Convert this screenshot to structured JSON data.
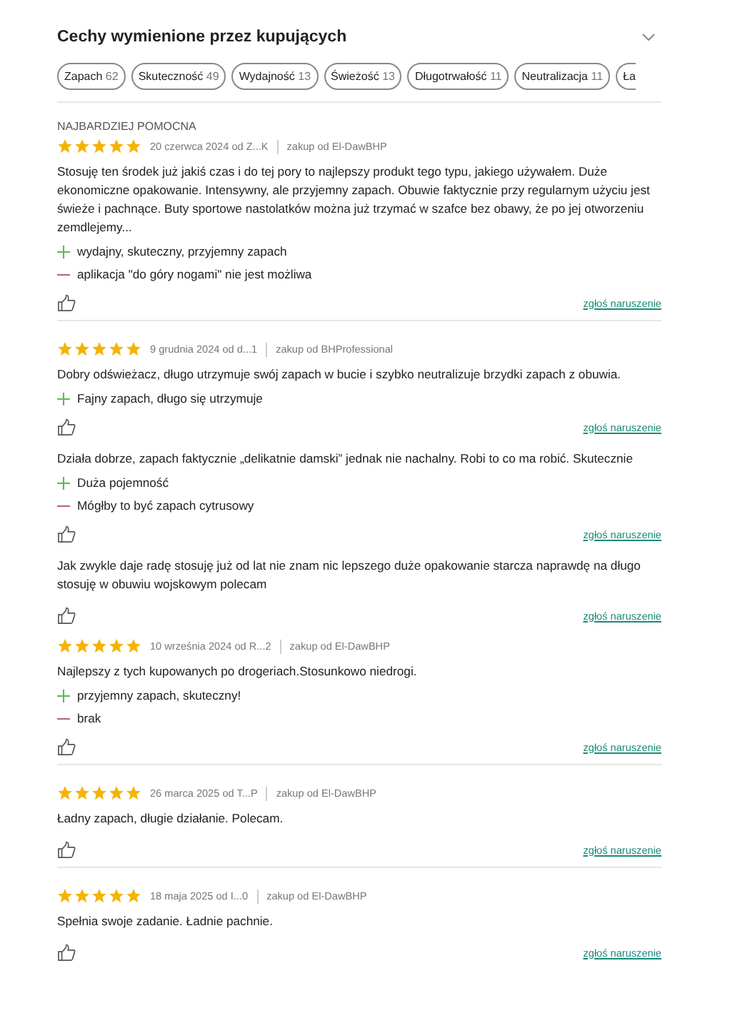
{
  "header": {
    "title": "Cechy wymienione przez kupujących",
    "expanded": false
  },
  "chips": [
    {
      "label": "Zapach",
      "count": "62"
    },
    {
      "label": "Skuteczność",
      "count": "49"
    },
    {
      "label": "Wydajność",
      "count": "13"
    },
    {
      "label": "Świeżość",
      "count": "13"
    },
    {
      "label": "Długotrwałość",
      "count": "11"
    },
    {
      "label": "Neutralizacja",
      "count": "11"
    },
    {
      "label": "Ła"
    }
  ],
  "reviews": [
    {
      "badge": "NAJBARDZIEJ POMOCNA",
      "stars": 5,
      "date": "20 czerwca 2024 od Z...K",
      "seller": "zakup od El-DawBHP",
      "text": "Stosuję ten środek już jakiś czas i do tej pory to najlepszy produkt tego typu, jakiego używałem. Duże ekonomiczne opakowanie. Intensywny, ale przyjemny zapach. Obuwie faktycznie przy regularnym użyciu jest świeże i pachnące. Buty sportowe nastolatków można już trzymać w szafce bez obawy, że po jej otworzeniu zemdlejemy...",
      "pros": [
        "wydajny, skuteczny, przyjemny zapach"
      ],
      "cons": [
        "aplikacja \"do góry nogami\" nie jest możliwa"
      ],
      "report": "zgłoś naruszenie",
      "separator": true
    },
    {
      "stars": 5,
      "date": "9 grudnia 2024 od d...1",
      "seller": "zakup od BHProfessional",
      "text": "Dobry odświeżacz, długo utrzymuje swój zapach w bucie i szybko neutralizuje brzydki zapach z obuwia.",
      "pros": [
        "Fajny zapach, długo się utrzymuje"
      ],
      "report": "zgłoś naruszenie",
      "separator": false
    },
    {
      "text": "Działa dobrze, zapach faktycznie „delikatnie damski” jednak nie nachalny. Robi to co ma robić. Skutecznie",
      "pros": [
        "Duża pojemność"
      ],
      "cons": [
        "Mógłby to być zapach cytrusowy"
      ],
      "report": "zgłoś naruszenie",
      "separator": false
    },
    {
      "text": "Jak zwykle daje radę stosuję już od lat nie znam nic lepszego duże opakowanie starcza naprawdę na długo stosuję w obuwiu wojskowym polecam",
      "report": "zgłoś naruszenie",
      "separator": false
    },
    {
      "stars": 5,
      "date": "10 września 2024 od R...2",
      "seller": "zakup od El-DawBHP",
      "text": "Najlepszy z tych kupowanych po drogeriach.Stosunkowo niedrogi.",
      "pros": [
        "przyjemny zapach, skuteczny!"
      ],
      "cons": [
        "brak"
      ],
      "report": "zgłoś naruszenie",
      "separator": true
    },
    {
      "stars": 5,
      "date": "26 marca 2025 od T...P",
      "seller": "zakup od El-DawBHP",
      "text": "Ładny zapach, długie działanie. Polecam.",
      "report": "zgłoś naruszenie",
      "separator": true
    },
    {
      "stars": 5,
      "date": "18 maja 2025 od I...0",
      "seller": "zakup od El-DawBHP",
      "text": "Spełnia swoje zadanie. Ładnie pachnie.",
      "report": "zgłoś naruszenie",
      "separator": false
    }
  ]
}
